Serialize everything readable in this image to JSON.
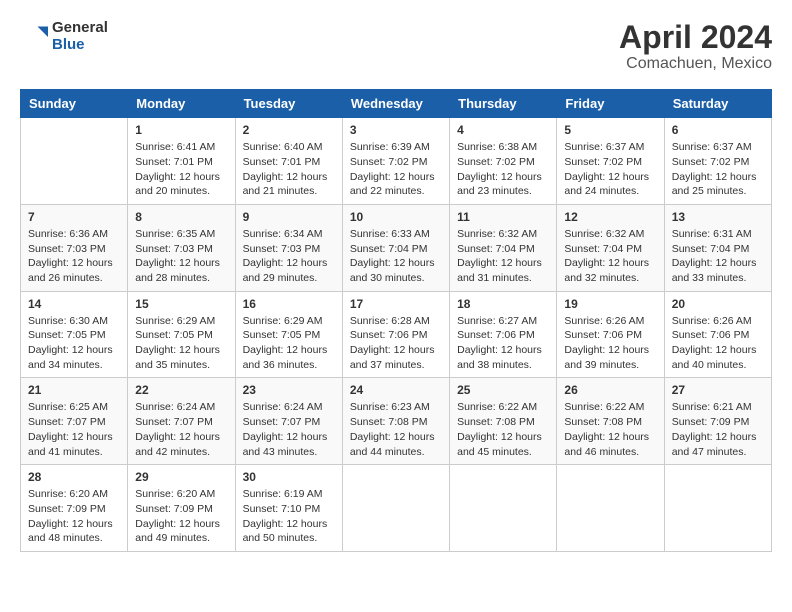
{
  "header": {
    "logo_general": "General",
    "logo_blue": "Blue",
    "month_title": "April 2024",
    "location": "Comachuen, Mexico"
  },
  "weekdays": [
    "Sunday",
    "Monday",
    "Tuesday",
    "Wednesday",
    "Thursday",
    "Friday",
    "Saturday"
  ],
  "weeks": [
    [
      {
        "day": "",
        "info": ""
      },
      {
        "day": "1",
        "info": "Sunrise: 6:41 AM\nSunset: 7:01 PM\nDaylight: 12 hours\nand 20 minutes."
      },
      {
        "day": "2",
        "info": "Sunrise: 6:40 AM\nSunset: 7:01 PM\nDaylight: 12 hours\nand 21 minutes."
      },
      {
        "day": "3",
        "info": "Sunrise: 6:39 AM\nSunset: 7:02 PM\nDaylight: 12 hours\nand 22 minutes."
      },
      {
        "day": "4",
        "info": "Sunrise: 6:38 AM\nSunset: 7:02 PM\nDaylight: 12 hours\nand 23 minutes."
      },
      {
        "day": "5",
        "info": "Sunrise: 6:37 AM\nSunset: 7:02 PM\nDaylight: 12 hours\nand 24 minutes."
      },
      {
        "day": "6",
        "info": "Sunrise: 6:37 AM\nSunset: 7:02 PM\nDaylight: 12 hours\nand 25 minutes."
      }
    ],
    [
      {
        "day": "7",
        "info": "Sunrise: 6:36 AM\nSunset: 7:03 PM\nDaylight: 12 hours\nand 26 minutes."
      },
      {
        "day": "8",
        "info": "Sunrise: 6:35 AM\nSunset: 7:03 PM\nDaylight: 12 hours\nand 28 minutes."
      },
      {
        "day": "9",
        "info": "Sunrise: 6:34 AM\nSunset: 7:03 PM\nDaylight: 12 hours\nand 29 minutes."
      },
      {
        "day": "10",
        "info": "Sunrise: 6:33 AM\nSunset: 7:04 PM\nDaylight: 12 hours\nand 30 minutes."
      },
      {
        "day": "11",
        "info": "Sunrise: 6:32 AM\nSunset: 7:04 PM\nDaylight: 12 hours\nand 31 minutes."
      },
      {
        "day": "12",
        "info": "Sunrise: 6:32 AM\nSunset: 7:04 PM\nDaylight: 12 hours\nand 32 minutes."
      },
      {
        "day": "13",
        "info": "Sunrise: 6:31 AM\nSunset: 7:04 PM\nDaylight: 12 hours\nand 33 minutes."
      }
    ],
    [
      {
        "day": "14",
        "info": "Sunrise: 6:30 AM\nSunset: 7:05 PM\nDaylight: 12 hours\nand 34 minutes."
      },
      {
        "day": "15",
        "info": "Sunrise: 6:29 AM\nSunset: 7:05 PM\nDaylight: 12 hours\nand 35 minutes."
      },
      {
        "day": "16",
        "info": "Sunrise: 6:29 AM\nSunset: 7:05 PM\nDaylight: 12 hours\nand 36 minutes."
      },
      {
        "day": "17",
        "info": "Sunrise: 6:28 AM\nSunset: 7:06 PM\nDaylight: 12 hours\nand 37 minutes."
      },
      {
        "day": "18",
        "info": "Sunrise: 6:27 AM\nSunset: 7:06 PM\nDaylight: 12 hours\nand 38 minutes."
      },
      {
        "day": "19",
        "info": "Sunrise: 6:26 AM\nSunset: 7:06 PM\nDaylight: 12 hours\nand 39 minutes."
      },
      {
        "day": "20",
        "info": "Sunrise: 6:26 AM\nSunset: 7:06 PM\nDaylight: 12 hours\nand 40 minutes."
      }
    ],
    [
      {
        "day": "21",
        "info": "Sunrise: 6:25 AM\nSunset: 7:07 PM\nDaylight: 12 hours\nand 41 minutes."
      },
      {
        "day": "22",
        "info": "Sunrise: 6:24 AM\nSunset: 7:07 PM\nDaylight: 12 hours\nand 42 minutes."
      },
      {
        "day": "23",
        "info": "Sunrise: 6:24 AM\nSunset: 7:07 PM\nDaylight: 12 hours\nand 43 minutes."
      },
      {
        "day": "24",
        "info": "Sunrise: 6:23 AM\nSunset: 7:08 PM\nDaylight: 12 hours\nand 44 minutes."
      },
      {
        "day": "25",
        "info": "Sunrise: 6:22 AM\nSunset: 7:08 PM\nDaylight: 12 hours\nand 45 minutes."
      },
      {
        "day": "26",
        "info": "Sunrise: 6:22 AM\nSunset: 7:08 PM\nDaylight: 12 hours\nand 46 minutes."
      },
      {
        "day": "27",
        "info": "Sunrise: 6:21 AM\nSunset: 7:09 PM\nDaylight: 12 hours\nand 47 minutes."
      }
    ],
    [
      {
        "day": "28",
        "info": "Sunrise: 6:20 AM\nSunset: 7:09 PM\nDaylight: 12 hours\nand 48 minutes."
      },
      {
        "day": "29",
        "info": "Sunrise: 6:20 AM\nSunset: 7:09 PM\nDaylight: 12 hours\nand 49 minutes."
      },
      {
        "day": "30",
        "info": "Sunrise: 6:19 AM\nSunset: 7:10 PM\nDaylight: 12 hours\nand 50 minutes."
      },
      {
        "day": "",
        "info": ""
      },
      {
        "day": "",
        "info": ""
      },
      {
        "day": "",
        "info": ""
      },
      {
        "day": "",
        "info": ""
      }
    ]
  ]
}
